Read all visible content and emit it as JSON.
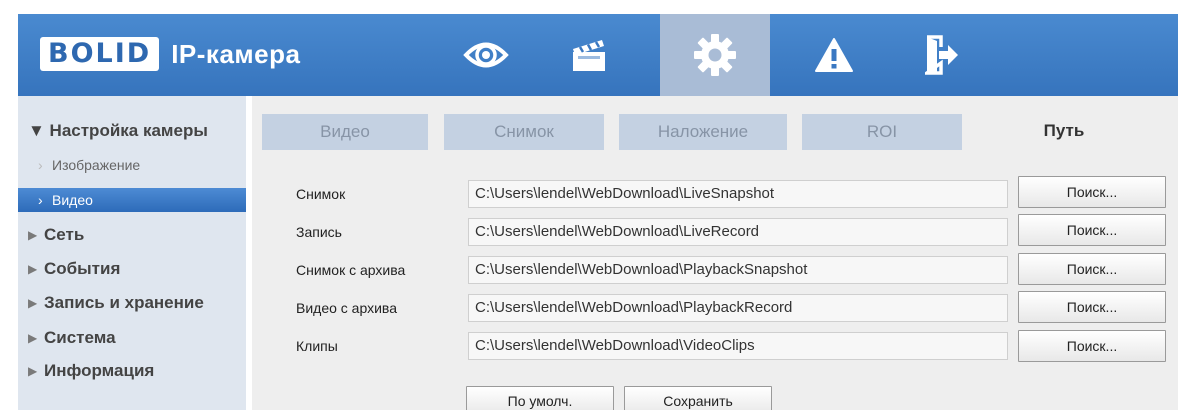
{
  "header": {
    "logo_box": "BOLID",
    "logo_text": "IP-камера",
    "nav": [
      {
        "icon": "eye-icon"
      },
      {
        "icon": "clapperboard-icon"
      },
      {
        "icon": "gear-icon",
        "active": true
      },
      {
        "icon": "warning-icon"
      },
      {
        "icon": "logout-icon"
      }
    ]
  },
  "sidebar": {
    "camera_settings": "▼ Настройка камеры",
    "image": "Изображение",
    "video": "Видео",
    "network": "Сеть",
    "events": "События",
    "storage": "Запись и хранение",
    "system": "Система",
    "info": "Информация"
  },
  "tabs": [
    "Видео",
    "Снимок",
    "Наложение",
    "ROI",
    "Путь"
  ],
  "active_tab": "Путь",
  "paths": [
    {
      "label": "Снимок",
      "value": "C:\\Users\\lendel\\WebDownload\\LiveSnapshot",
      "button": "Поиск..."
    },
    {
      "label": "Запись",
      "value": "C:\\Users\\lendel\\WebDownload\\LiveRecord",
      "button": "Поиск..."
    },
    {
      "label": "Снимок с архива",
      "value": "C:\\Users\\lendel\\WebDownload\\PlaybackSnapshot",
      "button": "Поиск..."
    },
    {
      "label": "Видео с архива",
      "value": "C:\\Users\\lendel\\WebDownload\\PlaybackRecord",
      "button": "Поиск..."
    },
    {
      "label": "Клипы",
      "value": "C:\\Users\\lendel\\WebDownload\\VideoClips",
      "button": "Поиск..."
    }
  ],
  "actions": {
    "default": "По умолч.",
    "save": "Сохранить"
  },
  "colors": {
    "header": "#3a78c2",
    "sidebar": "#dfe6ef",
    "active_item": "#3a7bc8",
    "tab_inactive": "#c4d1e2"
  }
}
